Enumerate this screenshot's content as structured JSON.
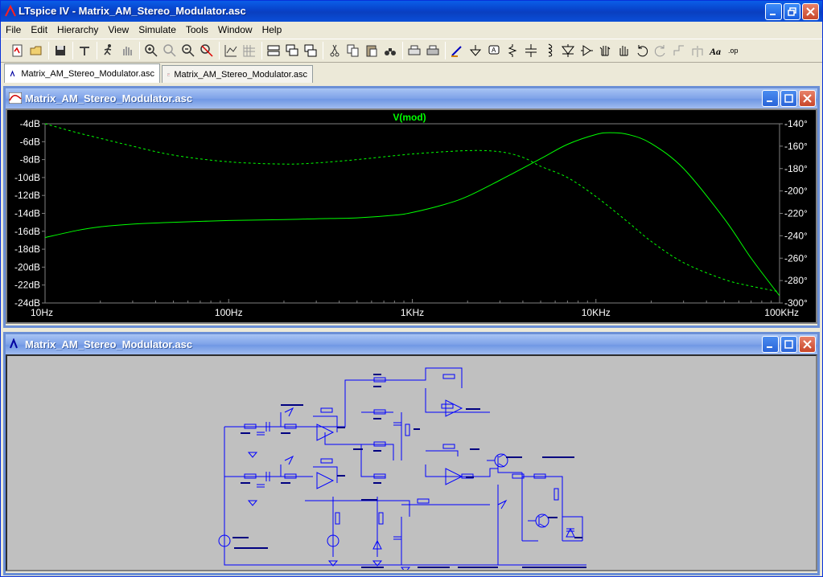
{
  "app": {
    "title": "LTspice IV - Matrix_AM_Stereo_Modulator.asc"
  },
  "menu": [
    {
      "label": "File",
      "key": "F"
    },
    {
      "label": "Edit",
      "key": "E"
    },
    {
      "label": "Hierarchy",
      "key": "H"
    },
    {
      "label": "View",
      "key": "V"
    },
    {
      "label": "Simulate",
      "key": "S"
    },
    {
      "label": "Tools",
      "key": "T"
    },
    {
      "label": "Window",
      "key": "W"
    },
    {
      "label": "Help",
      "key": "H"
    }
  ],
  "toolbar_icons": [
    "schematic-icon",
    "open-icon",
    "save-icon",
    "control-panel-icon",
    "run-icon",
    "halt-icon",
    "zoom-in-icon",
    "pan-icon",
    "zoom-out-icon",
    "zoom-fit-icon",
    "autorange-icon",
    "grid-icon",
    "tile-horizontal-icon",
    "cascade-icon",
    "tile-vertical-icon",
    "cut-icon",
    "copy-icon",
    "paste-icon",
    "find-icon",
    "print-setup-icon",
    "print-icon",
    "wire-icon",
    "ground-icon",
    "label-net-icon",
    "resistor-icon",
    "capacitor-icon",
    "inductor-icon",
    "diode-icon",
    "component-icon",
    "move-icon",
    "drag-icon",
    "undo-icon",
    "redo-icon",
    "rotate-icon",
    "mirror-icon",
    "text-icon",
    "spice-directive-icon"
  ],
  "tabs": [
    {
      "label": "Matrix_AM_Stereo_Modulator.asc",
      "kind": "schematic",
      "active": true
    },
    {
      "label": "Matrix_AM_Stereo_Modulator.asc",
      "kind": "waveform",
      "active": false
    }
  ],
  "waveform_window": {
    "title": "Matrix_AM_Stereo_Modulator.asc",
    "trace_label": "V(mod)"
  },
  "schematic_window": {
    "title": "Matrix_AM_Stereo_Modulator.asc"
  },
  "colors": {
    "trace": "#00ff00",
    "plot_bg": "#000000",
    "schematic_bg": "#c0c0c0",
    "wire": "#0000ff"
  },
  "chart_data": {
    "type": "line",
    "title": "V(mod)",
    "x_scale": "log",
    "xlim": [
      10,
      100000
    ],
    "x_ticks": [
      10,
      100,
      1000,
      10000,
      100000
    ],
    "x_tick_labels": [
      "10Hz",
      "100Hz",
      "1KHz",
      "10KHz",
      "100KHz"
    ],
    "ylim": [
      -24,
      -4
    ],
    "y_ticks": [
      -4,
      -6,
      -8,
      -10,
      -12,
      -14,
      -16,
      -18,
      -20,
      -22,
      -24
    ],
    "y_tick_labels": [
      "-4dB",
      "-6dB",
      "-8dB",
      "-10dB",
      "-12dB",
      "-14dB",
      "-16dB",
      "-18dB",
      "-20dB",
      "-22dB",
      "-24dB"
    ],
    "y2lim": [
      -300,
      -140
    ],
    "y2_ticks": [
      -140,
      -160,
      -180,
      -200,
      -220,
      -240,
      -260,
      -280,
      -300
    ],
    "y2_tick_labels": [
      "-140°",
      "-160°",
      "-180°",
      "-200°",
      "-220°",
      "-240°",
      "-260°",
      "-280°",
      "-300°"
    ],
    "grid": false,
    "series": [
      {
        "name": "V(mod)",
        "axis": "left",
        "style": "solid",
        "x": [
          10,
          15,
          20,
          30,
          50,
          100,
          200,
          300,
          500,
          800,
          1000,
          1500,
          2000,
          3000,
          5000,
          7000,
          10000,
          12000,
          15000,
          20000,
          30000,
          50000,
          70000,
          100000
        ],
        "y": [
          -16.7,
          -15.9,
          -15.5,
          -15.2,
          -15.0,
          -14.8,
          -14.7,
          -14.6,
          -14.5,
          -14.2,
          -13.9,
          -13.0,
          -12.1,
          -10.3,
          -7.9,
          -6.3,
          -5.2,
          -5.0,
          -5.2,
          -6.2,
          -9.0,
          -14.6,
          -19.0,
          -23.2
        ]
      },
      {
        "name": "phase",
        "axis": "right",
        "style": "dashed",
        "x": [
          10,
          15,
          20,
          30,
          50,
          100,
          200,
          300,
          500,
          1000,
          2000,
          3000,
          4000,
          5000,
          7000,
          10000,
          15000,
          20000,
          30000,
          50000,
          70000,
          100000
        ],
        "y": [
          -140,
          -148,
          -153,
          -160,
          -168,
          -174,
          -176,
          -175,
          -172,
          -167,
          -164,
          -165,
          -170,
          -178,
          -188,
          -205,
          -228,
          -245,
          -264,
          -279,
          -285,
          -290
        ]
      }
    ]
  }
}
